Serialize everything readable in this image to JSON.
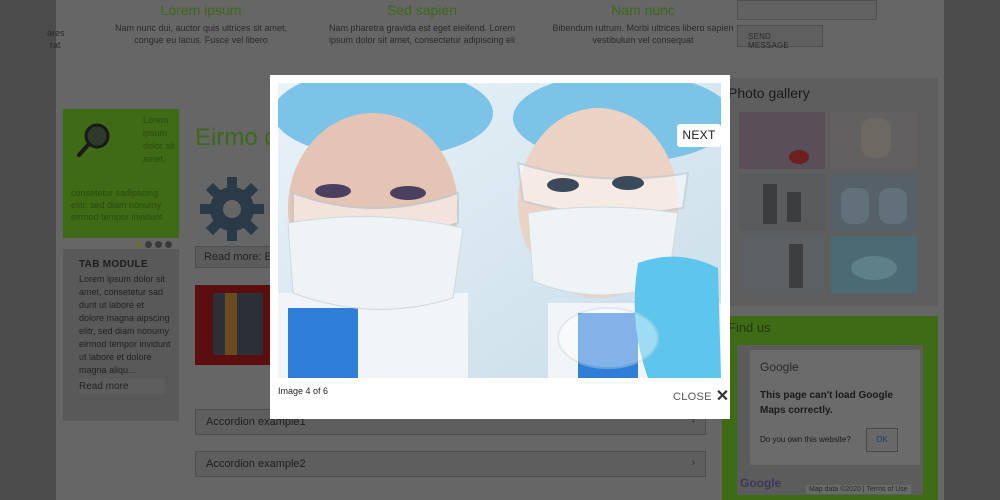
{
  "features": [
    {
      "title": "Lorem ipsum",
      "text": "Nam nunc dui, auctor quis ultrices sit amet, congue eu lacus. Fusce vel libero"
    },
    {
      "title": "Sed sapien",
      "text": "Nam pharetra gravida est eget eleifend. Lorem ipsum dolor sit amet, consectetur adipiscing eli"
    },
    {
      "title": "Nam nunc",
      "text": "Bibendum rutrum. Morbi ultrices libero sapien vestibulum vel consequat"
    }
  ],
  "feature_fragments": [
    "ares",
    "rat"
  ],
  "green_box": {
    "side_text": "Lorem ipsum dolor sit amet,",
    "bottom_text": "consetetur sadipscing elitr, sed diam nonumy eirmod tempor invidunt"
  },
  "tab_module": {
    "title": "TAB MODULE",
    "text": "Lorem ipsum dolor sit amet, consetetur sad dunt ut labore et dolore magna aipscing elitr, sed diam nonumy eirmod tempor invidunt ut labore et dolore magna aliqu...",
    "read_more": "Read more"
  },
  "center": {
    "title": "Eirmo d",
    "read_more": "Read more: El",
    "accordions": [
      "Accordion example1",
      "Accordion example2"
    ]
  },
  "contact": {
    "send_label": "SEND MESSAGE"
  },
  "gallery": {
    "title": "Photo gallery"
  },
  "find_us": {
    "title": "Find us",
    "google_label": "Google",
    "message": "This page can't load Google Maps correctly.",
    "question": "Do you own this website?",
    "ok_label": "OK",
    "badge": "Google",
    "map_data": "Map data ©2020 | Terms of Use"
  },
  "lightbox": {
    "caption": "Image 4 of 6",
    "next_label": "NEXT",
    "close_label": "CLOSE"
  },
  "icons": [
    "magnifier-icon",
    "gear-icon",
    "close-icon",
    "chevron-right-icon"
  ],
  "colors": {
    "accent_green": "#3f6b17",
    "overlay": "#5a5a5a",
    "lightbox_bg": "#ffffff"
  }
}
